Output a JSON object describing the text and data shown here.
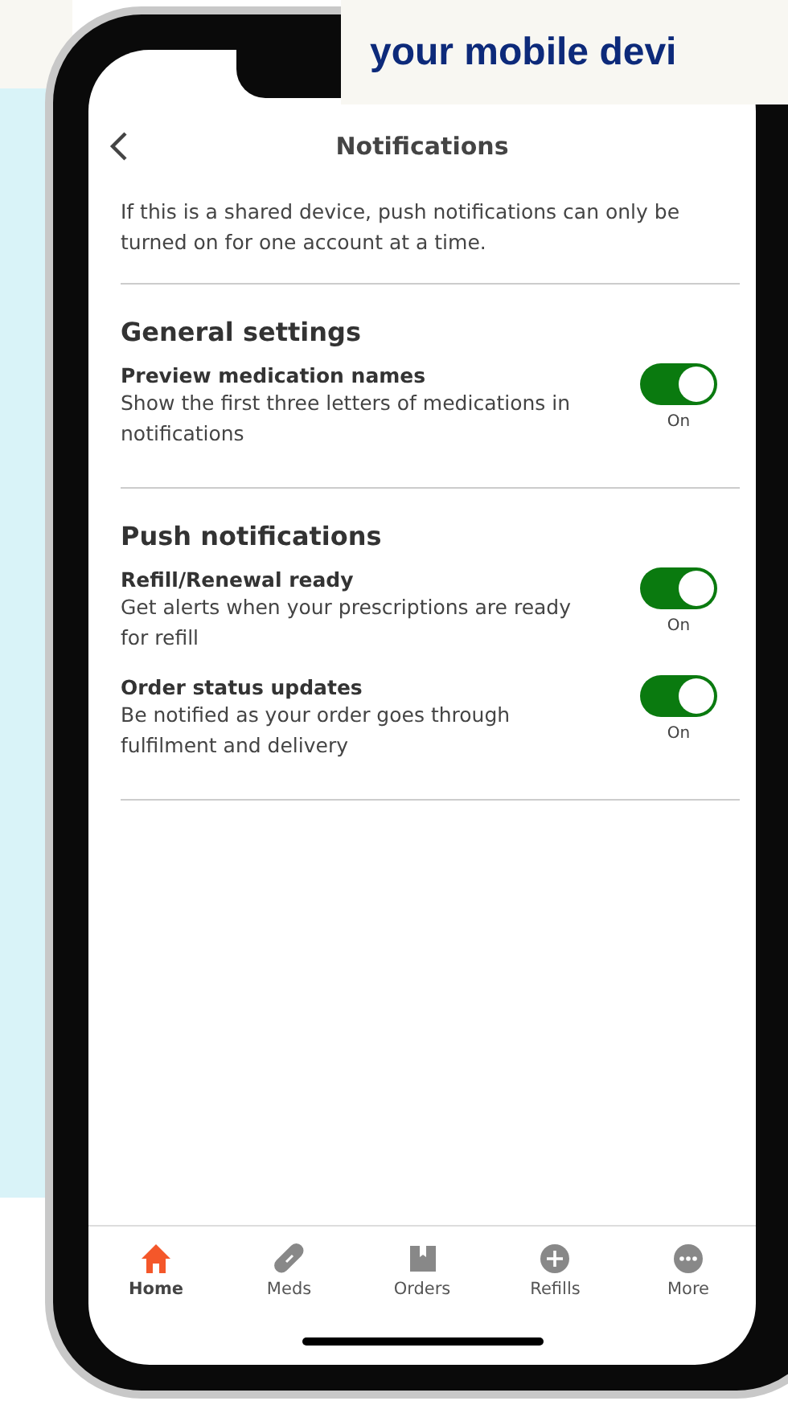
{
  "banner": {
    "text": "your mobile devi"
  },
  "header": {
    "title": "Notifications"
  },
  "intro": "If this is a shared device, push notifications can only be turned on for one account at a time.",
  "sections": [
    {
      "title": "General settings",
      "settings": [
        {
          "name": "Preview medication names",
          "description": "Show the first three letters of medications in notifications",
          "on": true,
          "state_label": "On"
        }
      ]
    },
    {
      "title": "Push notifications",
      "settings": [
        {
          "name": "Refill/Renewal ready",
          "description": "Get alerts when your prescriptions are ready for refill",
          "on": true,
          "state_label": "On"
        },
        {
          "name": "Order status updates",
          "description": "Be notified as your order goes through fulfilment and delivery",
          "on": true,
          "state_label": "On"
        }
      ]
    }
  ],
  "tab_bar": [
    {
      "kind": "home",
      "label": "Home",
      "selected": true
    },
    {
      "kind": "meds",
      "label": "Meds",
      "selected": false
    },
    {
      "kind": "orders",
      "label": "Orders",
      "selected": false
    },
    {
      "kind": "refills",
      "label": "Refills",
      "selected": false
    },
    {
      "kind": "more",
      "label": "More",
      "selected": false
    }
  ]
}
